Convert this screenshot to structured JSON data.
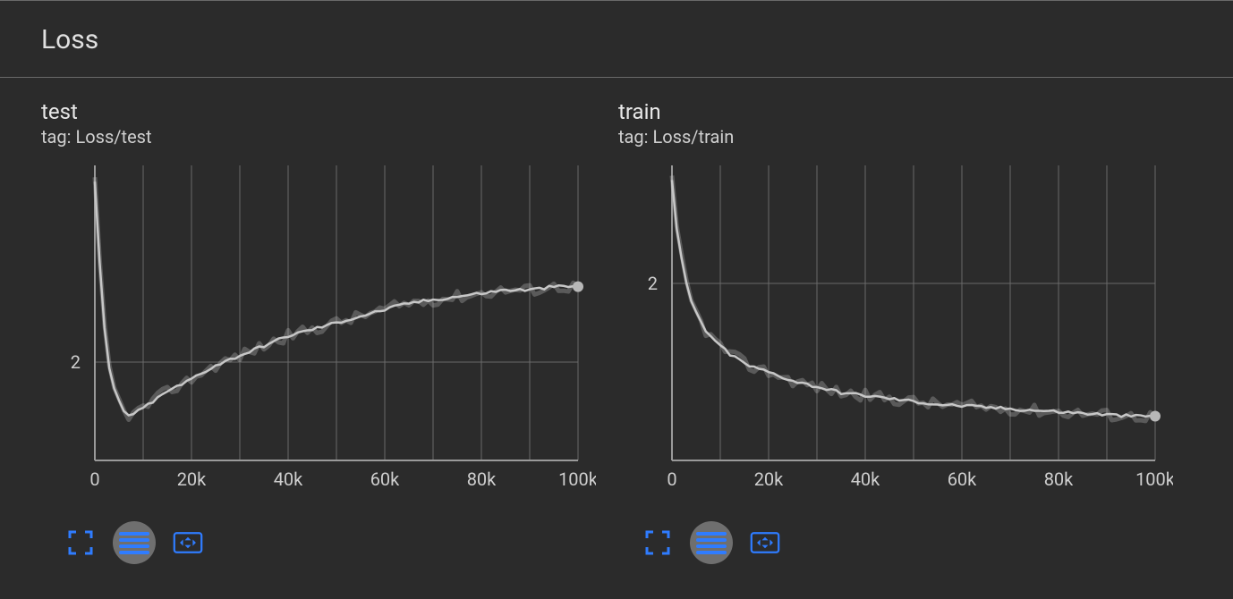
{
  "section_title": "Loss",
  "colors": {
    "bg": "#2b2b2b",
    "grid": "#6a6a6a",
    "axis": "#9a9a9a",
    "line": "#c7c7c7",
    "tick_text": "#cfcfcf",
    "accent": "#2f7cff"
  },
  "charts": [
    {
      "title": "test",
      "tag": "tag: Loss/test",
      "xticks": [
        "0",
        "20k",
        "40k",
        "60k",
        "80k",
        "100k"
      ],
      "yticks": [
        "2"
      ]
    },
    {
      "title": "train",
      "tag": "tag: Loss/train",
      "xticks": [
        "0",
        "20k",
        "40k",
        "60k",
        "80k",
        "100k"
      ],
      "yticks": [
        "2"
      ]
    }
  ],
  "chart_data": [
    {
      "type": "line",
      "title": "Loss/test",
      "xlabel": "",
      "ylabel": "",
      "xlim": [
        0,
        100000
      ],
      "ylim": [
        1.7,
        2.6
      ],
      "x": [
        0,
        1000,
        2000,
        3000,
        4000,
        5000,
        6000,
        7000,
        8000,
        9000,
        10000,
        12000,
        14000,
        16000,
        18000,
        20000,
        25000,
        30000,
        35000,
        40000,
        45000,
        50000,
        55000,
        60000,
        65000,
        70000,
        75000,
        80000,
        85000,
        90000,
        95000,
        100000
      ],
      "values": [
        2.55,
        2.3,
        2.1,
        1.98,
        1.92,
        1.88,
        1.85,
        1.84,
        1.84,
        1.85,
        1.86,
        1.88,
        1.9,
        1.92,
        1.93,
        1.95,
        1.99,
        2.02,
        2.05,
        2.08,
        2.1,
        2.12,
        2.14,
        2.16,
        2.18,
        2.19,
        2.2,
        2.21,
        2.22,
        2.22,
        2.23,
        2.23
      ]
    },
    {
      "type": "line",
      "title": "Loss/train",
      "xlabel": "",
      "ylabel": "",
      "xlim": [
        0,
        100000
      ],
      "ylim": [
        1.4,
        2.4
      ],
      "x": [
        0,
        1000,
        2000,
        3000,
        4000,
        5000,
        6000,
        7000,
        8000,
        9000,
        10000,
        12000,
        14000,
        16000,
        18000,
        20000,
        25000,
        30000,
        35000,
        40000,
        45000,
        50000,
        55000,
        60000,
        65000,
        70000,
        75000,
        80000,
        85000,
        90000,
        95000,
        100000
      ],
      "values": [
        2.35,
        2.18,
        2.08,
        2.0,
        1.94,
        1.9,
        1.87,
        1.84,
        1.82,
        1.8,
        1.79,
        1.76,
        1.74,
        1.72,
        1.71,
        1.7,
        1.67,
        1.65,
        1.63,
        1.62,
        1.61,
        1.6,
        1.59,
        1.585,
        1.58,
        1.575,
        1.57,
        1.565,
        1.56,
        1.555,
        1.55,
        1.55
      ]
    }
  ]
}
